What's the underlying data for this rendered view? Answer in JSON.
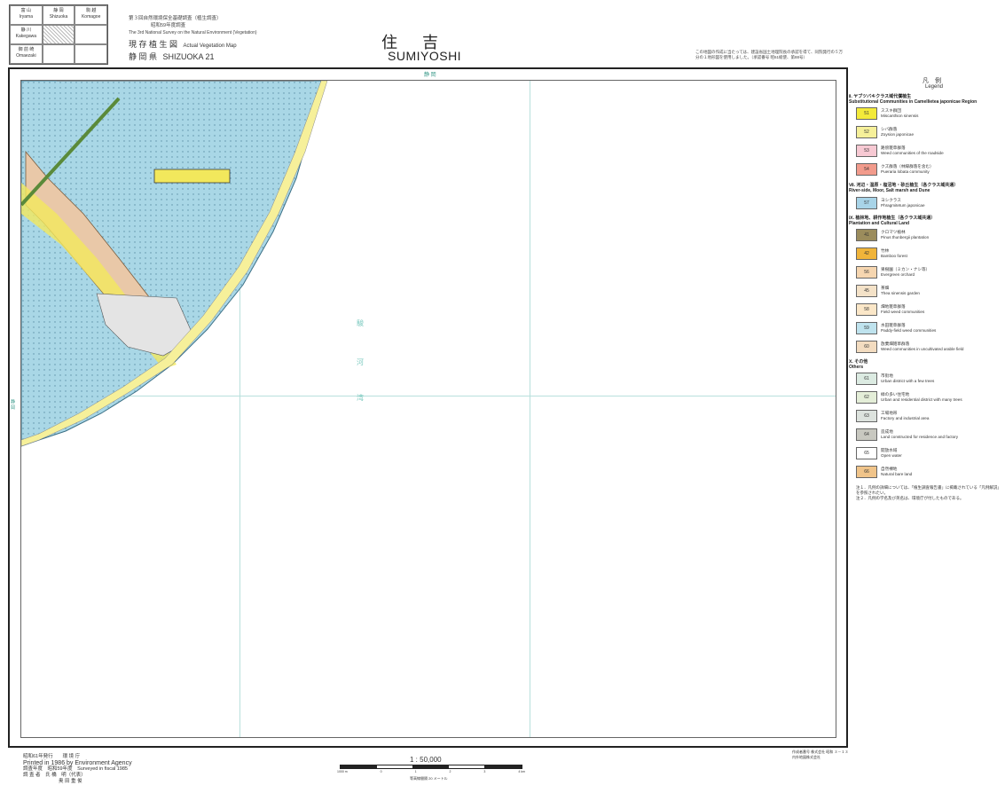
{
  "index_map": {
    "cells": [
      {
        "jp": "富 山",
        "en": "Iryama"
      },
      {
        "jp": "静 岡",
        "en": "Shizuoka"
      },
      {
        "jp": "駒 越",
        "en": "Komagoe"
      },
      {
        "jp": "静 川",
        "en": "Kakegawa"
      },
      {
        "jp": "",
        "en": ""
      },
      {
        "jp": "",
        "en": ""
      },
      {
        "jp": "御 前 崎",
        "en": "Omaezaki"
      },
      {
        "jp": "",
        "en": ""
      },
      {
        "jp": "",
        "en": ""
      }
    ]
  },
  "header": {
    "survey_jp": "第３回自然環境保全基礎調査（植生調査）",
    "year_jp": "昭和59年度調査",
    "survey_en": "The 3rd National Survey on the Natural Environment (Vegetation)",
    "map_type": "現 存 植 生 図",
    "map_type_en": "Actual Vegetation Map",
    "prefecture": "静 岡 県",
    "sheet": "SHIZUOKA 21",
    "title_jp": "住吉",
    "title_en": "SUMIYOSHI",
    "note_jp": "この地図の作成に当たっては、建設省国土地理院長の承認を得て、同院発行の５万分の１地形図を使用しました。（承認番号 昭61総使、第88号）"
  },
  "map": {
    "top_label": "静 岡",
    "left_label": "静 岡",
    "sea_label": [
      "駿",
      "河",
      "湾"
    ]
  },
  "legend": {
    "title_jp": "凡　例",
    "title_en": "Legend",
    "sections": [
      {
        "heading": "Ⅱ. ヤブツバキクラス域代償植生",
        "heading_en": "Substitutional Communities in Camellietea japonicae Region"
      },
      {
        "heading": "Ⅶ. 河辺・湿原・塩沼地・砂丘植生（各クラス域共通）",
        "heading_en": "River-side, Moor, Salt marsh and Dune"
      },
      {
        "heading": "Ⅸ. 植林地、耕作地植生（各クラス域共通）",
        "heading_en": "Plantation and Cultural Land"
      },
      {
        "heading": "Ⅹ. その他",
        "heading_en": "Others"
      }
    ],
    "items": [
      {
        "code": "51",
        "jp": "ススキ群団",
        "en": "Miscanthion sinensis",
        "color": "#f3ea3a"
      },
      {
        "code": "52",
        "jp": "シバ群落",
        "en": "Zoysion japonicae",
        "color": "#f6f09a"
      },
      {
        "code": "53",
        "jp": "路傍雑草群落",
        "en": "Weed communities of the roadside",
        "color": "#f7c9d3"
      },
      {
        "code": "54",
        "jp": "クズ群落（林縁群落を含む）",
        "en": "Pueraria lobata community",
        "color": "#f29b8c"
      },
      {
        "code": "57",
        "jp": "ヨシクラス",
        "en": "Phragmitetum japonicae",
        "color": "#a8d4e8"
      },
      {
        "code": "41",
        "jp": "クロマツ植林",
        "en": "Pinus thunbergii plantation",
        "color": "#9b8c5c"
      },
      {
        "code": "42",
        "jp": "竹林",
        "en": "Bamboo forest",
        "color": "#f0b43a"
      },
      {
        "code": "56",
        "jp": "果樹園（ミカン・ナシ等）",
        "en": "Evergreen orchard",
        "color": "#f6d6b0"
      },
      {
        "code": "45",
        "jp": "茶畑",
        "en": "Thea sinensis garden",
        "color": "#f4e2c8"
      },
      {
        "code": "58",
        "jp": "畑地雑草群落",
        "en": "Field weed communities",
        "color": "#fbe7c8"
      },
      {
        "code": "59",
        "jp": "水田雑草群落",
        "en": "Paddy-field weed communities",
        "color": "#bfe3ee"
      },
      {
        "code": "60",
        "jp": "放棄畑雑草群落",
        "en": "Weed communities in uncultivated arable field",
        "color": "#f3dcc0"
      },
      {
        "code": "61",
        "jp": "市街地",
        "en": "Urban district with a few trees",
        "color": "#dcebe2"
      },
      {
        "code": "62",
        "jp": "緑の多い住宅地",
        "en": "Urban and residential district with many trees",
        "color": "#e4eed8"
      },
      {
        "code": "63",
        "jp": "工場地帯",
        "en": "Factory and industrial area",
        "color": "#dde3de"
      },
      {
        "code": "64",
        "jp": "造成地",
        "en": "Land constructed for residence and factory",
        "color": "#c8c8c0"
      },
      {
        "code": "65",
        "jp": "開放水域",
        "en": "Open water",
        "color": "#ffffff"
      },
      {
        "code": "66",
        "jp": "自然裸地",
        "en": "Natural bare land",
        "color": "#f0c48a"
      }
    ],
    "notes": [
      "注１．凡例の詳細については、「植生調査報告書」に掲載されている「凡例解説」を参照されたい。",
      "注２．凡例の学名及び英名は、環境庁が付したものである。"
    ]
  },
  "footer": {
    "published_jp": "昭和61年発行　　環 境 庁",
    "printed_en": "Printed in 1986 by Environment Agency",
    "surveyed": "調査年度　昭和59年度　Surveyed in fiscal 1985",
    "surveyor": "調 査 者　氏 橋　明（代表）",
    "surveyor2": "奥 田 重 俊",
    "scale": "1 : 50,000",
    "scale_ticks": [
      "1000 m",
      "0",
      "1",
      "2",
      "3",
      "4 km"
    ],
    "scale_note": "等高線間隔 20 メートル",
    "credit_jp": "作成者番号 株式会社 昭和 ３－１３",
    "credit2_jp": "内外地図株式会社"
  },
  "colors": {
    "paddy_blue": "#a9d7e6",
    "urban_gray": "#dcdcdc",
    "field_yellow": "#f2e85c",
    "road_green": "#5a8a3a",
    "grid_cyan": "#b8e0dc"
  }
}
